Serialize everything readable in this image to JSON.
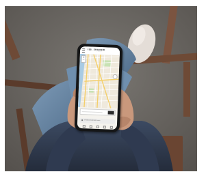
{
  "scene": {
    "description_alt": "Person holding a smartphone displaying a street map",
    "colors": {
      "floor": "#6f6b66",
      "jeans": "#5d7d9c",
      "sweater": "#35425a",
      "skin": "#c9987c",
      "chair_wood": "#6e4a36",
      "phone_body": "#151617"
    }
  },
  "browser": {
    "site_title": "ISS. SHADOW",
    "site_subtitle": "·· —— ··",
    "url": "shadowandstreets.com",
    "icons": [
      "menu-icon",
      "lock-icon",
      "zoom-in-icon",
      "zoom-out-icon",
      "location-icon"
    ]
  },
  "map": {
    "zoom_in": "+",
    "zoom_out": "−",
    "colors": {
      "land": "#efe9dc",
      "water": "#a9cbe4",
      "park": "#c8e2b4",
      "road": "#f4cf6a"
    }
  }
}
